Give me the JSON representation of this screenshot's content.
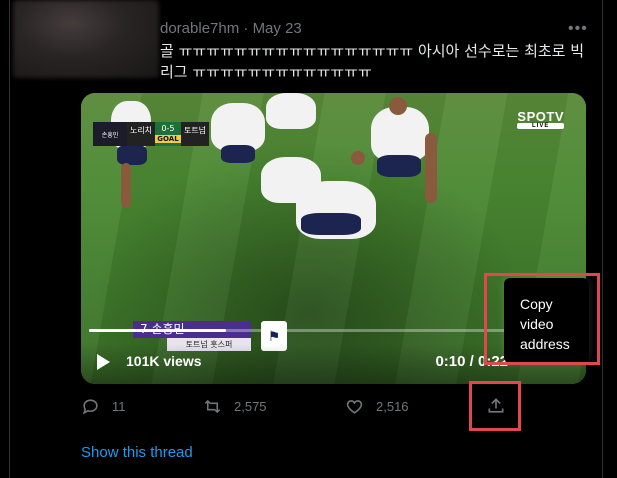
{
  "tweet": {
    "author_handle": "dorable7hm",
    "date": "May 23",
    "meta_separator": "·",
    "more_label": "•••",
    "text": "골 ㅠㅠㅠㅠㅠㅠㅠㅠㅠㅠㅠㅠㅠㅠㅠㅠㅠ 아시아 선수로는 최초로 빅리그 ㅠㅠㅠㅠㅠㅠㅠㅠㅠㅠㅠㅠㅠ"
  },
  "video": {
    "views": "101K views",
    "time": "0:10 / 0:22",
    "progress_fraction": 0.28,
    "scorebug": {
      "home_player": "손흥민",
      "home_team": "노리치",
      "score": "0-5",
      "away_team": "토트넘",
      "goal_label": "GOAL"
    },
    "broadcaster": {
      "name": "SPOTV",
      "sub": "LIVE"
    },
    "player_graphic": {
      "number_name": "7  손흥민",
      "team_label": "토트넘 홋스퍼"
    }
  },
  "context_menu": {
    "item_label": "Copy video address"
  },
  "actions": {
    "replies": "11",
    "retweets": "2,575",
    "likes": "2,516"
  },
  "show_thread": "Show this thread",
  "colors": {
    "background": "#000000",
    "text": "#e7e9ea",
    "muted": "#71767b",
    "link": "#1d9bf0",
    "highlight": "#e1484d"
  }
}
